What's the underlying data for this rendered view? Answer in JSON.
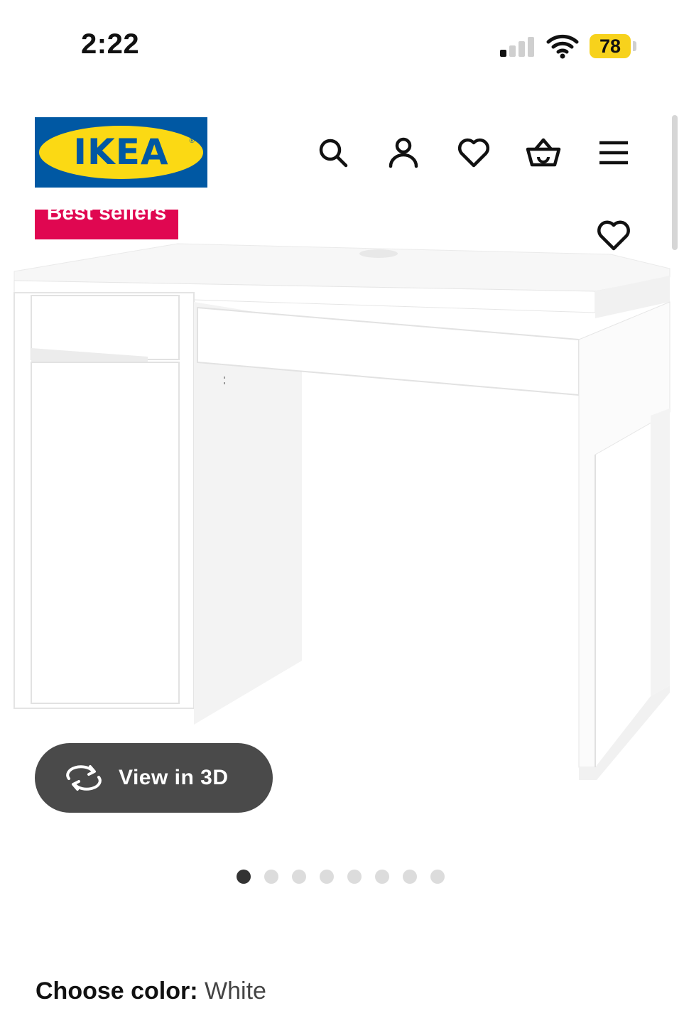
{
  "status_bar": {
    "time": "2:22",
    "battery": "78"
  },
  "brand": {
    "logo_text": "IKEA",
    "registered": "®"
  },
  "header_icons": [
    "search-icon",
    "user-icon",
    "heart-icon",
    "basket-icon",
    "menu-icon"
  ],
  "product": {
    "badge": "Best sellers",
    "view_3d_label": "View in 3D",
    "gallery": {
      "image_count": 8,
      "active_index": 0
    },
    "color_label": "Choose color:",
    "color_value": "White"
  },
  "colors": {
    "ikea_blue": "#0058a3",
    "ikea_yellow": "#fbd914",
    "badge_pink": "#e00751",
    "battery_yellow": "#f7d21c"
  }
}
